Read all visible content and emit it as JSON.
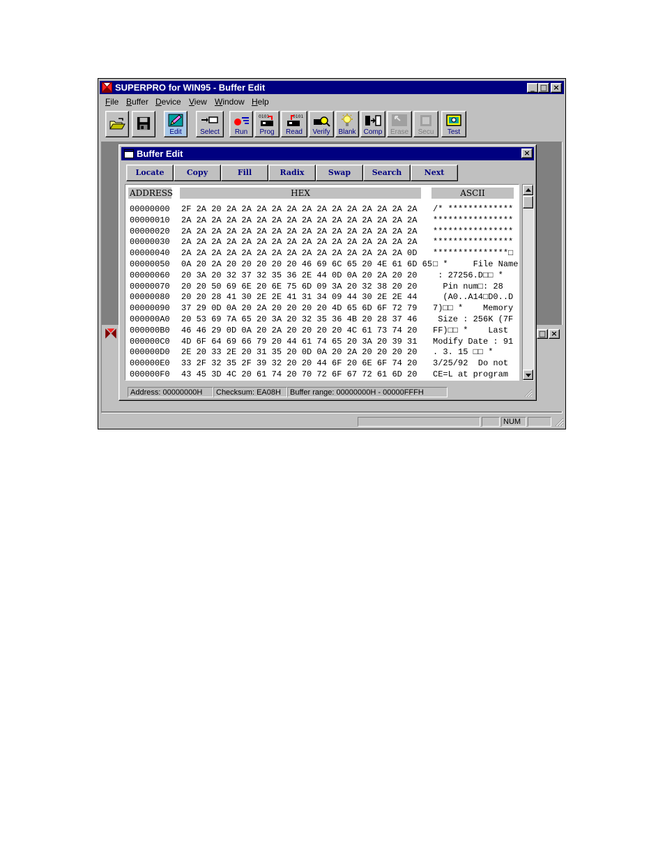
{
  "app": {
    "title": "SUPERPRO for WIN95 - Buffer Edit",
    "menu": [
      {
        "label": "File",
        "u": "F",
        "rest": "ile"
      },
      {
        "label": "Buffer",
        "u": "B",
        "rest": "uffer"
      },
      {
        "label": "Device",
        "u": "D",
        "rest": "evice"
      },
      {
        "label": "View",
        "u": "V",
        "rest": "iew"
      },
      {
        "label": "Window",
        "u": "W",
        "rest": "indow"
      },
      {
        "label": "Help",
        "u": "H",
        "rest": "elp"
      }
    ],
    "toolbar": {
      "open_icon": "folder-open-icon",
      "save_icon": "floppy-disk-icon",
      "buttons": [
        {
          "label": "Edit",
          "icon": "pencil-edit-icon"
        },
        {
          "label": "Select",
          "icon": "select-device-icon"
        },
        {
          "label": "Run",
          "icon": "run-icon"
        },
        {
          "label": "Prog",
          "icon": "program-icon"
        },
        {
          "label": "Read",
          "icon": "read-icon"
        },
        {
          "label": "Verify",
          "icon": "verify-icon"
        },
        {
          "label": "Blank",
          "icon": "blank-check-icon"
        },
        {
          "label": "Comp",
          "icon": "compare-icon"
        },
        {
          "label": "Erase",
          "icon": "erase-icon",
          "disabled": true
        },
        {
          "label": "Secu",
          "icon": "security-icon",
          "disabled": true
        },
        {
          "label": "Test",
          "icon": "test-icon"
        }
      ]
    },
    "statusbar": {
      "num": "NUM"
    },
    "window_controls": {
      "minimize": "_",
      "maximize": "□",
      "close": "×"
    }
  },
  "buffer_edit": {
    "title": "Buffer Edit",
    "commands": [
      "Locate",
      "Copy",
      "Fill",
      "Radix",
      "Swap",
      "Search",
      "Next"
    ],
    "headers": {
      "address": "ADDRESS",
      "hex": "HEX",
      "ascii": "ASCII"
    },
    "rows": [
      {
        "address": "00000000",
        "hex": "2F 2A 20 2A 2A 2A 2A 2A 2A 2A 2A 2A 2A 2A 2A 2A",
        "ascii": "/* *************"
      },
      {
        "address": "00000010",
        "hex": "2A 2A 2A 2A 2A 2A 2A 2A 2A 2A 2A 2A 2A 2A 2A 2A",
        "ascii": "****************"
      },
      {
        "address": "00000020",
        "hex": "2A 2A 2A 2A 2A 2A 2A 2A 2A 2A 2A 2A 2A 2A 2A 2A",
        "ascii": "****************"
      },
      {
        "address": "00000030",
        "hex": "2A 2A 2A 2A 2A 2A 2A 2A 2A 2A 2A 2A 2A 2A 2A 2A",
        "ascii": "****************"
      },
      {
        "address": "00000040",
        "hex": "2A 2A 2A 2A 2A 2A 2A 2A 2A 2A 2A 2A 2A 2A 2A 0D",
        "ascii": "***************□"
      },
      {
        "address": "00000050",
        "hex": "0A 20 2A 20 20 20 20 20 46 69 6C 65 20 4E 61 6D 65",
        "ascii": "□ *     File Name"
      },
      {
        "address": "00000060",
        "hex": "20 3A 20 32 37 32 35 36 2E 44 0D 0A 20 2A 20 20",
        "ascii": " : 27256.D□□ *"
      },
      {
        "address": "00000070",
        "hex": "20 20 50 69 6E 20 6E 75 6D 09 3A 20 32 38 20 20",
        "ascii": "  Pin num□: 28"
      },
      {
        "address": "00000080",
        "hex": "20 20 28 41 30 2E 2E 41 31 34 09 44 30 2E 2E 44",
        "ascii": "  (A0..A14□D0..D"
      },
      {
        "address": "00000090",
        "hex": "37 29 0D 0A 20 2A 20 20 20 20 4D 65 6D 6F 72 79",
        "ascii": "7)□□ *    Memory"
      },
      {
        "address": "000000A0",
        "hex": "20 53 69 7A 65 20 3A 20 32 35 36 4B 20 28 37 46",
        "ascii": " Size : 256K (7F"
      },
      {
        "address": "000000B0",
        "hex": "46 46 29 0D 0A 20 2A 20 20 20 20 4C 61 73 74 20",
        "ascii": "FF)□□ *    Last"
      },
      {
        "address": "000000C0",
        "hex": "4D 6F 64 69 66 79 20 44 61 74 65 20 3A 20 39 31",
        "ascii": "Modify Date : 91"
      },
      {
        "address": "000000D0",
        "hex": "2E 20 33 2E 20 31 35 20 0D 0A 20 2A 20 20 20 20",
        "ascii": ". 3. 15 □□ *"
      },
      {
        "address": "000000E0",
        "hex": "33 2F 32 35 2F 39 32 20 20 44 6F 20 6E 6F 74 20",
        "ascii": "3/25/92  Do not"
      },
      {
        "address": "000000F0",
        "hex": "43 45 3D 4C 20 61 74 20 70 72 6F 67 72 61 6D 20",
        "ascii": "CE=L at program"
      }
    ],
    "status": {
      "address": "Address: 00000000H",
      "checksum": "Checksum: EA08H",
      "range": "Buffer range: 00000000H - 00000FFFH"
    }
  },
  "colors": {
    "titlebar": "#000080",
    "face": "#c0c0c0",
    "workspace": "#808080",
    "button_text": "#000080"
  }
}
